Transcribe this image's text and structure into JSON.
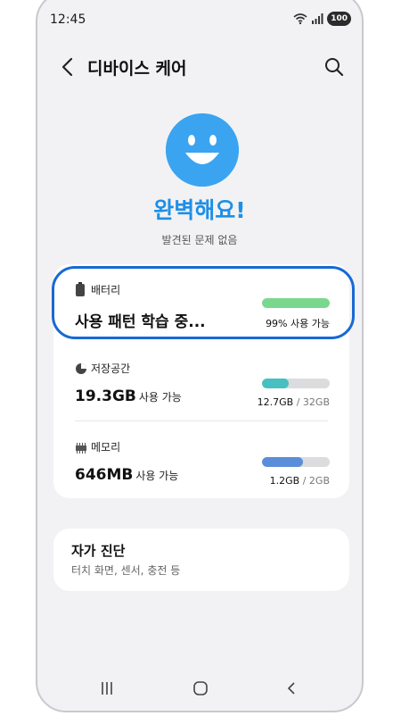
{
  "status_bar": {
    "time": "12:45",
    "battery_level": "100",
    "wifi_icon": "wifi-icon",
    "signal_icon": "signal-icon"
  },
  "header": {
    "title": "디바이스 케어",
    "back_icon": "back-icon",
    "search_icon": "search-icon"
  },
  "summary": {
    "headline": "완벽해요!",
    "subtext": "발견된 문제 없음",
    "face_icon": "smiley-face-icon"
  },
  "items": [
    {
      "label": "배터리",
      "icon": "battery-icon",
      "value": "사용 패턴 학습 중...",
      "value_unit": "",
      "bar_fraction": 1.0,
      "bar_color": "#7ad88d",
      "caption_main": "99% 사용 가능",
      "caption_total": ""
    },
    {
      "label": "저장공간",
      "icon": "storage-pie-icon",
      "value": "19.3GB",
      "value_unit": "사용 가능",
      "bar_fraction": 0.4,
      "bar_color": "#46c0c0",
      "caption_main": "12.7GB",
      "caption_total": " / 32GB"
    },
    {
      "label": "메모리",
      "icon": "memory-chip-icon",
      "value": "646MB",
      "value_unit": "사용 가능",
      "bar_fraction": 0.6,
      "bar_color": "#5b8ed8",
      "caption_main": "1.2GB",
      "caption_total": " / 2GB"
    }
  ],
  "diagnostics": {
    "title": "자가 진단",
    "subtitle": "터치 화면, 센서, 충전 등"
  },
  "colors": {
    "accent": "#1e8fe6",
    "highlight": "#1769d4"
  }
}
